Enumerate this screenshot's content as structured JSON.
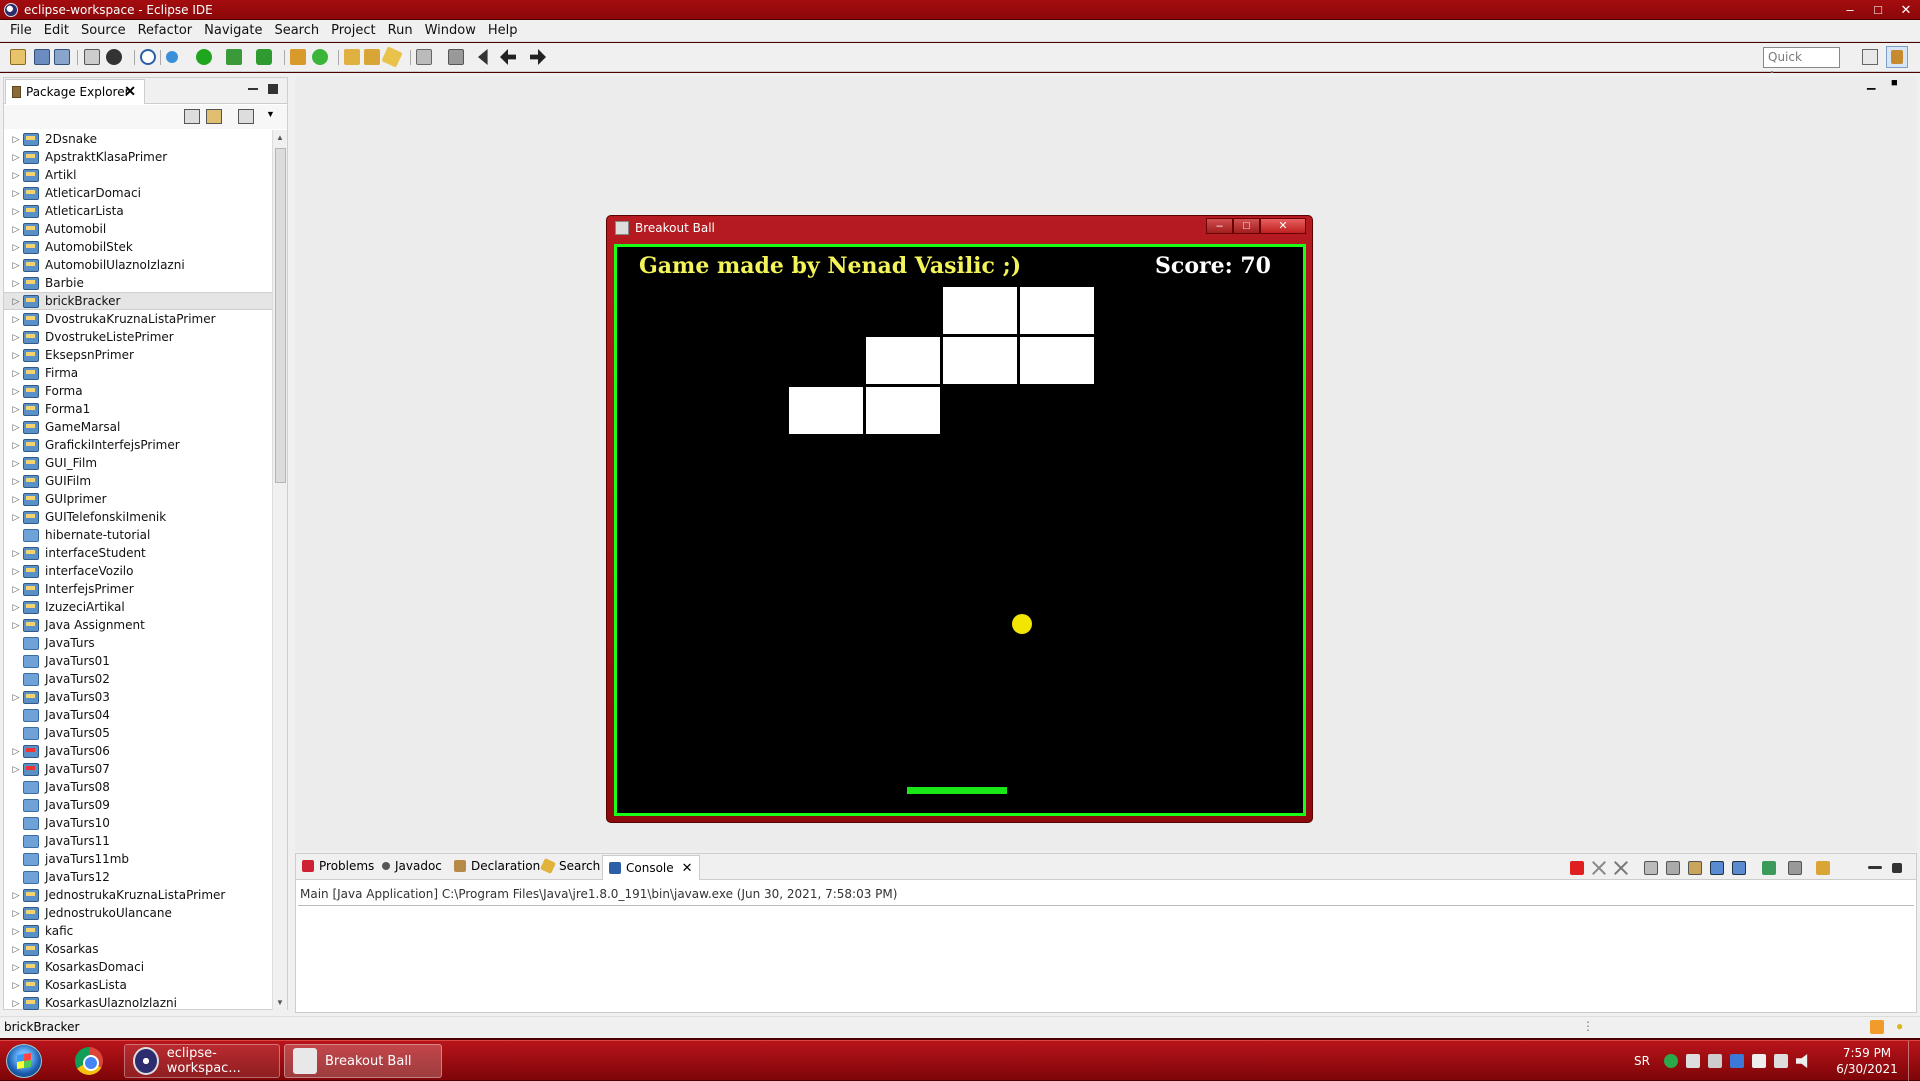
{
  "window": {
    "title": "eclipse-workspace - Eclipse IDE",
    "btn_min": "–",
    "btn_max": "□",
    "btn_close": "✕"
  },
  "menu": [
    "File",
    "Edit",
    "Source",
    "Refactor",
    "Navigate",
    "Search",
    "Project",
    "Run",
    "Window",
    "Help"
  ],
  "toolbar": {
    "quick_access": "Quick Access"
  },
  "package_explorer": {
    "title": "Package Explorer",
    "selected": "brickBracker",
    "projects": [
      {
        "name": "2Dsnake",
        "type": "project",
        "expand": true
      },
      {
        "name": "ApstraktKlasaPrimer",
        "type": "project",
        "expand": true
      },
      {
        "name": "Artikl",
        "type": "project",
        "expand": true
      },
      {
        "name": "AtleticarDomaci",
        "type": "project",
        "expand": true
      },
      {
        "name": "AtleticarLista",
        "type": "project",
        "expand": true
      },
      {
        "name": "Automobil",
        "type": "project",
        "expand": true
      },
      {
        "name": "AutomobilStek",
        "type": "project",
        "expand": true
      },
      {
        "name": "AutomobilUlaznoIzlazni",
        "type": "project",
        "expand": true
      },
      {
        "name": "Barbie",
        "type": "project",
        "expand": true
      },
      {
        "name": "brickBracker",
        "type": "project",
        "expand": true
      },
      {
        "name": "DvostrukaKruznaListaPrimer",
        "type": "project",
        "expand": true
      },
      {
        "name": "DvostrukeListePrimer",
        "type": "project",
        "expand": true
      },
      {
        "name": "EksepsnPrimer",
        "type": "project",
        "expand": true
      },
      {
        "name": "Firma",
        "type": "project",
        "expand": true
      },
      {
        "name": "Forma",
        "type": "project",
        "expand": true
      },
      {
        "name": "Forma1",
        "type": "project",
        "expand": true
      },
      {
        "name": "GameMarsal",
        "type": "project",
        "expand": true
      },
      {
        "name": "GrafickiInterfejsPrimer",
        "type": "project",
        "expand": true
      },
      {
        "name": "GUI_Film",
        "type": "project",
        "expand": true
      },
      {
        "name": "GUIFilm",
        "type": "project",
        "expand": true
      },
      {
        "name": "GUIprimer",
        "type": "project",
        "expand": true
      },
      {
        "name": "GUITelefonskiImenik",
        "type": "project",
        "expand": true
      },
      {
        "name": "hibernate-tutorial",
        "type": "folder",
        "expand": false
      },
      {
        "name": "interfaceStudent",
        "type": "project",
        "expand": true
      },
      {
        "name": "interfaceVozilo",
        "type": "project",
        "expand": true
      },
      {
        "name": "InterfejsPrimer",
        "type": "project",
        "expand": true
      },
      {
        "name": "IzuzeciArtikal",
        "type": "project",
        "expand": true
      },
      {
        "name": "Java Assignment",
        "type": "project",
        "expand": true
      },
      {
        "name": "JavaTurs",
        "type": "folder",
        "expand": false
      },
      {
        "name": "JavaTurs01",
        "type": "folder",
        "expand": false
      },
      {
        "name": "JavaTurs02",
        "type": "folder",
        "expand": false
      },
      {
        "name": "JavaTurs03",
        "type": "project",
        "expand": true
      },
      {
        "name": "JavaTurs04",
        "type": "folder",
        "expand": false
      },
      {
        "name": "JavaTurs05",
        "type": "folder",
        "expand": false
      },
      {
        "name": "JavaTurs06",
        "type": "project-err",
        "expand": true
      },
      {
        "name": "JavaTurs07",
        "type": "project-err",
        "expand": true
      },
      {
        "name": "JavaTurs08",
        "type": "folder",
        "expand": false
      },
      {
        "name": "JavaTurs09",
        "type": "folder",
        "expand": false
      },
      {
        "name": "JavaTurs10",
        "type": "folder",
        "expand": false
      },
      {
        "name": "JavaTurs11",
        "type": "folder",
        "expand": false
      },
      {
        "name": "javaTurs11mb",
        "type": "folder",
        "expand": false
      },
      {
        "name": "JavaTurs12",
        "type": "folder",
        "expand": false
      },
      {
        "name": "JednostrukaKruznaListaPrimer",
        "type": "project",
        "expand": true
      },
      {
        "name": "JednostrukoUlancane",
        "type": "project",
        "expand": true
      },
      {
        "name": "kafic",
        "type": "project",
        "expand": true
      },
      {
        "name": "Kosarkas",
        "type": "project",
        "expand": true
      },
      {
        "name": "KosarkasDomaci",
        "type": "project",
        "expand": true
      },
      {
        "name": "KosarkasLista",
        "type": "project",
        "expand": true
      },
      {
        "name": "KosarkasUlaznoIzlazni",
        "type": "project",
        "expand": true
      }
    ]
  },
  "console": {
    "tabs": [
      "Problems",
      "Javadoc",
      "Declaration",
      "Search",
      "Console"
    ],
    "active_tab": "Console",
    "launch_line": "Main [Java Application] C:\\Program Files\\Java\\jre1.8.0_191\\bin\\javaw.exe (Jun 30, 2021, 7:58:03 PM)"
  },
  "statusbar": {
    "text": "brickBracker"
  },
  "game": {
    "title": "Breakout Ball",
    "author_text": "Game made by Nenad Vasilic ;)",
    "score_text": "Score: 70",
    "colors": {
      "background": "#000000",
      "border": "#1aff1a",
      "bricks": "#ffffff",
      "ball": "#f2e600",
      "paddle": "#18e818",
      "author": "#f3f35a",
      "score": "#ffffff"
    },
    "brick_map": [
      [
        0,
        0,
        0,
        0,
        1,
        1
      ],
      [
        0,
        0,
        0,
        1,
        1,
        1
      ],
      [
        0,
        0,
        1,
        1,
        0,
        0
      ]
    ]
  },
  "taskbar": {
    "items": [
      {
        "label": "eclipse-workspac...",
        "icon": "eclipse-icon"
      },
      {
        "label": "Breakout Ball",
        "icon": "java-icon"
      }
    ],
    "lang": "SR",
    "time": "7:59 PM",
    "date": "6/30/2021"
  }
}
